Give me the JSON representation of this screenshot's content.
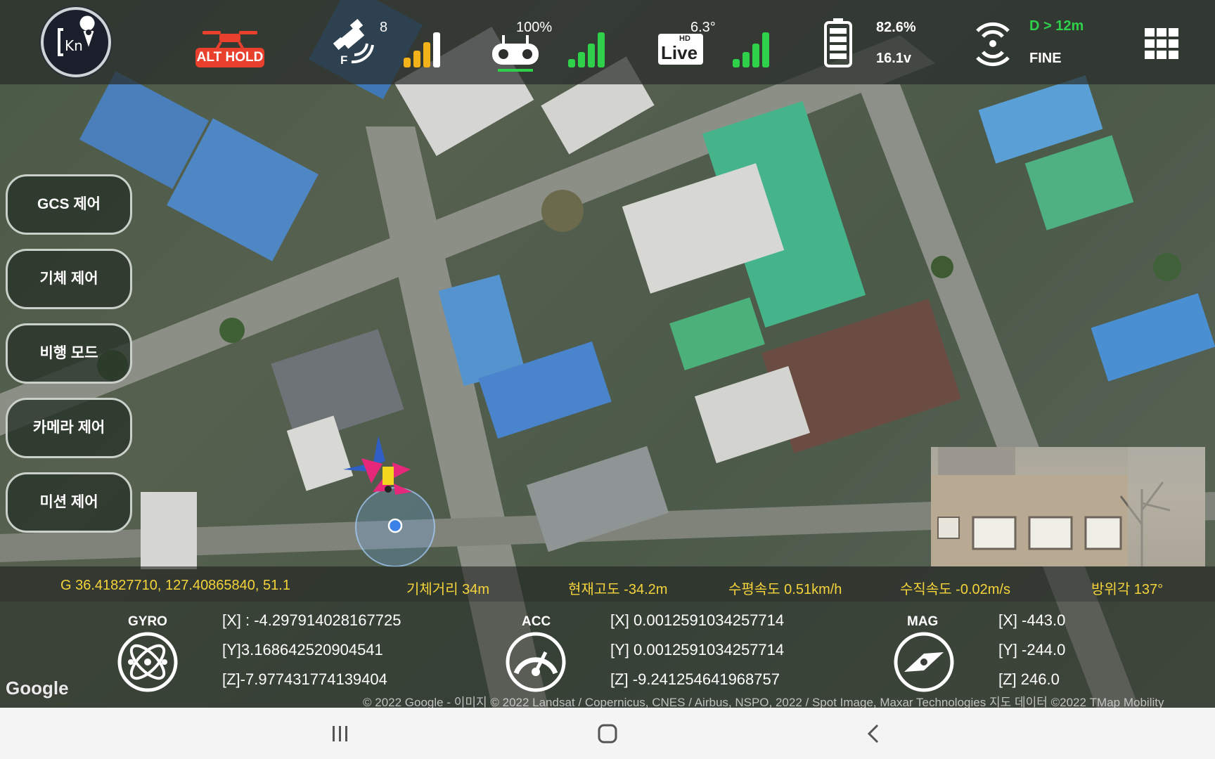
{
  "status_bar": {
    "mode_label": "ALT HOLD",
    "satellite_count": "8",
    "satellite_fix_label": "F",
    "rc_signal_percent": "100%",
    "live_label": "Live",
    "live_hd_label": "HD",
    "video_value": "6.3°",
    "battery_percent": "82.6%",
    "battery_voltage": "16.1v",
    "distance_label": "D > 12m",
    "link_quality": "FINE",
    "colors": {
      "accent_green": "#2fd04a",
      "signal_yellow": "#f3b21a",
      "alt_hold_red": "#e8402d"
    }
  },
  "menu": [
    {
      "label": "GCS 제어"
    },
    {
      "label": "기체 제어"
    },
    {
      "label": "비행 모드"
    },
    {
      "label": "카메라 제어"
    },
    {
      "label": "미션 제어"
    }
  ],
  "info": {
    "gps": "G 36.41827710, 127.40865840, 51.1",
    "distance": "기체거리 34m",
    "altitude": "현재고도 -34.2m",
    "h_speed": "수평속도 0.51km/h",
    "v_speed": "수직속도 -0.02m/s",
    "heading": "방위각 137°"
  },
  "sensors": {
    "gyro": {
      "title": "GYRO",
      "x": "[X] : -4.297914028167725",
      "y": "[Y]3.168642520904541",
      "z": "[Z]-7.977431774139404"
    },
    "acc": {
      "title": "ACC",
      "x": "[X] 0.0012591034257714",
      "y": "[Y] 0.0012591034257714",
      "z": "[Z] -9.241254641968757"
    },
    "mag": {
      "title": "MAG",
      "x": "[X] -443.0",
      "y": "[Y] -244.0",
      "z": "[Z] 246.0"
    }
  },
  "map": {
    "attribution_logo": "Google",
    "copyright": "© 2022 Google - 이미지 © 2022 Landsat / Copernicus, CNES / Airbus, NSPO, 2022 / Spot Image, Maxar Technologies 지도 데이터 ©2022 TMap Mobility"
  },
  "icons": {
    "logo": "kn-location-logo",
    "satellite": "satellite-icon",
    "controller": "rc-controller-icon",
    "battery": "battery-icon",
    "wifi": "wifi-link-icon",
    "grid": "grid-menu-icon"
  }
}
